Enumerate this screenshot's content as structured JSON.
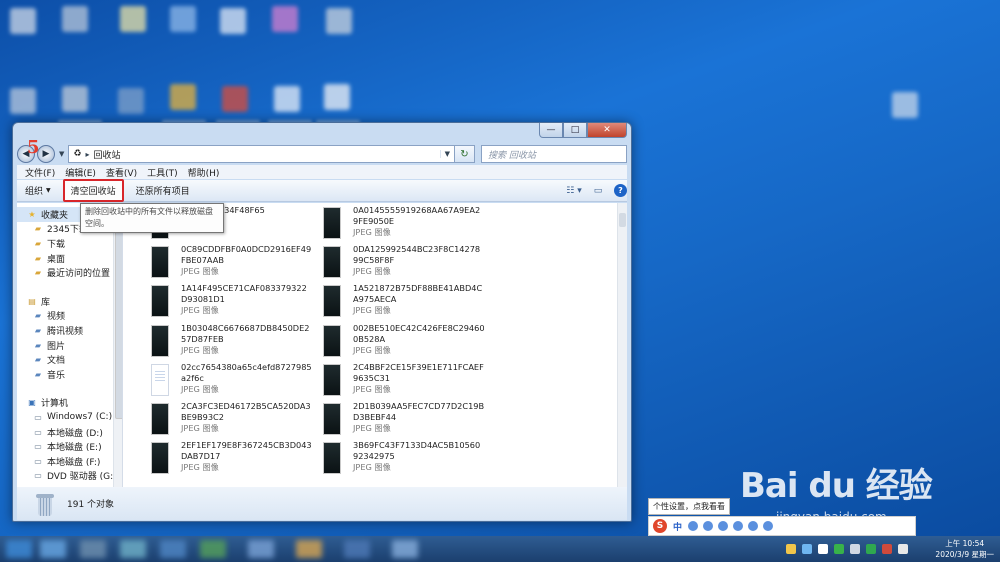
{
  "window": {
    "title": "回收站",
    "step_marker": "5",
    "search_placeholder": "搜索 回收站",
    "caption": {
      "minimize": "—",
      "maximize": "□",
      "close": "✕"
    }
  },
  "menu": [
    "文件(F)",
    "编辑(E)",
    "查看(V)",
    "工具(T)",
    "帮助(H)"
  ],
  "toolbar": {
    "organize": "组织",
    "empty_bin": "清空回收站",
    "restore_all": "还原所有项目"
  },
  "tooltip": "删除回收站中的所有文件以释放磁盘空间。",
  "navpane": {
    "favorites": "收藏夹",
    "fav_items": [
      "2345下载",
      "下载",
      "桌面",
      "最近访问的位置"
    ],
    "library": "库",
    "lib_items": [
      "视频",
      "腾讯视频",
      "图片",
      "文档",
      "音乐"
    ],
    "computer": "计算机",
    "drives": [
      "Windows7 (C:)",
      "本地磁盘 (D:)",
      "本地磁盘 (E:)",
      "本地磁盘 (F:)",
      "DVD 驱动器 (G:)"
    ]
  },
  "files": [
    {
      "name": "6E52DB5234F48F65",
      "type": "JPEG 图像",
      "kind": "img"
    },
    {
      "name": "0A0145555919268AA67A9EA29FE9050E",
      "type": "JPEG 图像",
      "kind": "img"
    },
    {
      "name": "0C89CDDFBF0A0DCD2916EF49FBE07AAB",
      "type": "JPEG 图像",
      "kind": "img"
    },
    {
      "name": "0DA125992544BC23F8C1427899C58F8F",
      "type": "JPEG 图像",
      "kind": "img"
    },
    {
      "name": "1A14F495CE71CAF083379322D93081D1",
      "type": "JPEG 图像",
      "kind": "img"
    },
    {
      "name": "1A521872B75DF88BE41ABD4CA975AECA",
      "type": "JPEG 图像",
      "kind": "img"
    },
    {
      "name": "1B03048C6676687DB8450DE257D87FEB",
      "type": "JPEG 图像",
      "kind": "img"
    },
    {
      "name": "002BE510EC42C426FE8C294600B528A",
      "type": "JPEG 图像",
      "kind": "img"
    },
    {
      "name": "02cc7654380a65c4efd8727985a2f6c",
      "type": "JPEG 图像",
      "kind": "doc"
    },
    {
      "name": "2C4BBF2CE15F39E1E711FCAEF9635C31",
      "type": "JPEG 图像",
      "kind": "img"
    },
    {
      "name": "2CA3FC3ED46172B5CA520DA3BE9B93C2",
      "type": "JPEG 图像",
      "kind": "img"
    },
    {
      "name": "2D1B039AA5FEC7CD77D2C19BD3BEBF44",
      "type": "JPEG 图像",
      "kind": "img"
    },
    {
      "name": "2EF1EF179E8F367245CB3D043DAB7D17",
      "type": "JPEG 图像",
      "kind": "img"
    },
    {
      "name": "3B69FC43F7133D4AC5B1056092342975",
      "type": "JPEG 图像",
      "kind": "img"
    }
  ],
  "status": {
    "count": "191 个对象"
  },
  "ime": {
    "tip": "个性设置，点我看看",
    "logo": "S",
    "lang": "中"
  },
  "watermark": {
    "brand": "Bai du 经验",
    "url": "jingyan.baidu.com"
  },
  "clock": {
    "time": "上午 10:54",
    "date": "2020/3/9 星期一"
  }
}
